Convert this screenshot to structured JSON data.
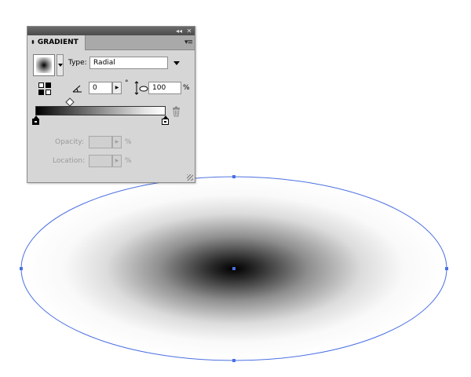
{
  "panel": {
    "collapse_glyph": "◂◂",
    "close_glyph": "✕",
    "tab_arrows": "⬍",
    "tab_label": "GRADIENT",
    "menu_glyph": "▾≡",
    "type_label": "Type:",
    "type_value": "Radial",
    "angle_value": "0",
    "angle_unit": "°",
    "aspect_value": "100",
    "aspect_unit": "%",
    "opacity_label": "Opacity:",
    "opacity_value": "",
    "opacity_unit": "%",
    "location_label": "Location:",
    "location_value": "",
    "location_unit": "%",
    "icons": {
      "swatch": "gradient-swatch-icon",
      "reverse": "reverse-gradient-icon",
      "angle": "angle-icon",
      "aspect": "aspect-ratio-icon",
      "trash": "trash-icon"
    },
    "stops": [
      {
        "color": "#000000",
        "location": 0
      },
      {
        "color": "#ffffff",
        "location": 100
      }
    ],
    "midpoint_location": 25
  },
  "artwork": {
    "shape": "ellipse",
    "fill": "radial gradient black to white",
    "selection_color": "#4a6fe3"
  }
}
